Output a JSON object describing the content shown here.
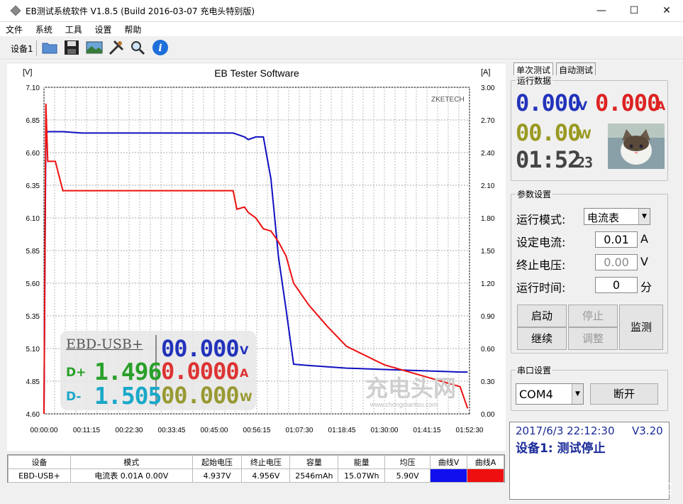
{
  "window": {
    "title": "EB测试系统软件 V1.8.5 (Build 2016-03-07 充电头特别版)",
    "minimize": "—",
    "maximize": "☐",
    "close": "✕"
  },
  "menu": [
    "文件",
    "系统",
    "工具",
    "设置",
    "帮助"
  ],
  "toolbar": {
    "device_label": "设备1",
    "buttons": [
      "open-folder-icon",
      "save-icon",
      "image-icon",
      "tools-icon",
      "search-icon",
      "info-icon"
    ]
  },
  "chart": {
    "title": "EB Tester Software",
    "brand": "ZKETECH",
    "left_unit": "[V]",
    "right_unit": "[A]",
    "voltage_color": "#1010c0",
    "current_color": "#ee1010",
    "overlay": {
      "device": "EBD-USB+",
      "dplus_label": "D+",
      "dplus_value": "1.496",
      "dminus_label": "D-",
      "dminus_value": "1.505",
      "v_value": "00.000",
      "v_unit": "V",
      "a_value": "0.0000",
      "a_unit": "A",
      "w_value": "00.000",
      "w_unit": "W"
    },
    "watermark": "充电头网",
    "watermark_url": "www.chongdiantou.com"
  },
  "chart_data": {
    "type": "line",
    "title": "EB Tester Software",
    "ylabel": "[V]",
    "y2label": "[A]",
    "ylim": [
      4.6,
      7.1
    ],
    "y2lim": [
      0.0,
      3.0
    ],
    "y_ticks": [
      "7.10",
      "6.85",
      "6.60",
      "6.35",
      "6.10",
      "5.85",
      "5.60",
      "5.35",
      "5.10",
      "4.85",
      "4.60"
    ],
    "y2_ticks": [
      "3.00",
      "2.70",
      "2.40",
      "2.10",
      "1.80",
      "1.50",
      "1.20",
      "0.90",
      "0.60",
      "0.30",
      "0.00"
    ],
    "x_ticks": [
      "00:00:00",
      "00:11:15",
      "00:22:30",
      "00:33:45",
      "00:45:00",
      "00:56:15",
      "01:07:30",
      "01:18:45",
      "01:30:00",
      "01:41:15",
      "01:52:30"
    ],
    "x_minutes": [
      0,
      0.5,
      1,
      3,
      5,
      10,
      20,
      30,
      40,
      50,
      51,
      53,
      54,
      56,
      58,
      60,
      62,
      64,
      66,
      70,
      75,
      80,
      90,
      100,
      110,
      112
    ],
    "series": [
      {
        "name": "曲线V",
        "color": "#1010c0",
        "values": [
          4.6,
          6.75,
          6.76,
          6.76,
          6.76,
          6.75,
          6.75,
          6.75,
          6.75,
          6.75,
          6.74,
          6.72,
          6.7,
          6.72,
          6.72,
          6.4,
          5.8,
          5.4,
          4.98,
          4.97,
          4.96,
          4.95,
          4.94,
          4.93,
          4.92,
          4.92
        ]
      },
      {
        "name": "曲线A",
        "color": "#ee1010",
        "values": [
          0.0,
          2.85,
          2.32,
          2.32,
          2.05,
          2.05,
          2.05,
          2.05,
          2.05,
          2.05,
          1.88,
          1.9,
          1.85,
          1.8,
          1.7,
          1.68,
          1.58,
          1.45,
          1.2,
          1.0,
          0.8,
          0.62,
          0.45,
          0.35,
          0.25,
          0.05
        ]
      }
    ]
  },
  "tabs": [
    "单次测试",
    "自动测试"
  ],
  "run_data": {
    "title": "运行数据",
    "voltage": "0.000",
    "voltage_unit": "V",
    "current": "0.000",
    "current_unit": "A",
    "power": "00.00",
    "power_unit": "W",
    "time": "01:52",
    "seconds": "23"
  },
  "params": {
    "title": "参数设置",
    "mode_label": "运行模式:",
    "mode_value": "电流表",
    "current_label": "设定电流:",
    "current_value": "0.01",
    "current_unit": "A",
    "stop_v_label": "终止电压:",
    "stop_v_value": "0.00",
    "stop_v_unit": "V",
    "time_label": "运行时间:",
    "time_value": "0",
    "time_unit": "分",
    "btn_start": "启动",
    "btn_stop": "停止",
    "btn_continue": "继续",
    "btn_adjust": "调整",
    "btn_monitor": "监测"
  },
  "serial": {
    "title": "串口设置",
    "port": "COM4",
    "disconnect": "断开"
  },
  "status": {
    "datetime": "2017/6/3 22:12:30",
    "version": "V3.20",
    "message": "设备1: 测试停止"
  },
  "table": {
    "headers": [
      "设备",
      "模式",
      "起始电压",
      "终止电压",
      "容量",
      "能量",
      "均压",
      "曲线V",
      "曲线A"
    ],
    "row": [
      "EBD-USB+",
      "电流表  0.01A  0.00V",
      "4.937V",
      "4.956V",
      "2546mAh",
      "15.07Wh",
      "5.90V",
      "",
      ""
    ]
  },
  "site_watermark": "值 什么值得买"
}
